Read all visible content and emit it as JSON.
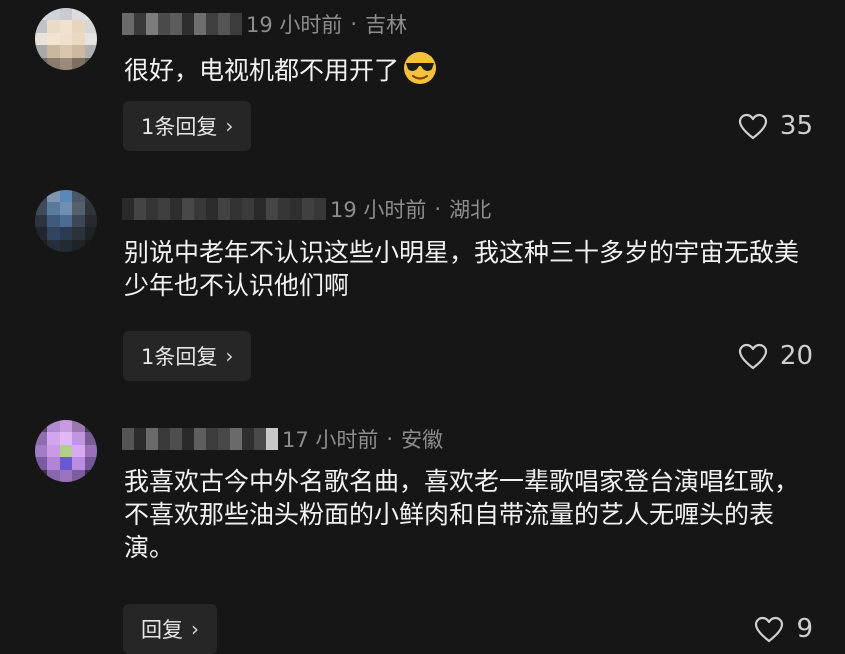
{
  "comments": [
    {
      "time": "19 小时前",
      "separator": "·",
      "location": "吉林",
      "text": "很好，电视机都不用开了",
      "emoji": "cool-sunglasses-emoji",
      "reply_label": "1条回复",
      "likes": "35"
    },
    {
      "time": "19 小时前",
      "separator": "·",
      "location": "湖北",
      "text": "别说中老年不认识这些小明星，我这种三十多岁的宇宙无敌美少年也不认识他们啊",
      "reply_label": "1条回复",
      "likes": "20"
    },
    {
      "time": "17 小时前",
      "separator": "·",
      "location": "安徽",
      "text": "我喜欢古今中外名歌名曲，喜欢老一辈歌唱家登台演唱红歌，不喜欢那些油头粉面的小鲜肉和自带流量的艺人无喱头的表演。",
      "reply_label": "回复",
      "likes": "9"
    }
  ],
  "icons": {
    "like": "heart-outline-icon",
    "reply_arrow": "chevron-right-icon"
  },
  "colors": {
    "background": "#161616",
    "meta": "#8d8d8d",
    "button_bg": "#262626"
  }
}
